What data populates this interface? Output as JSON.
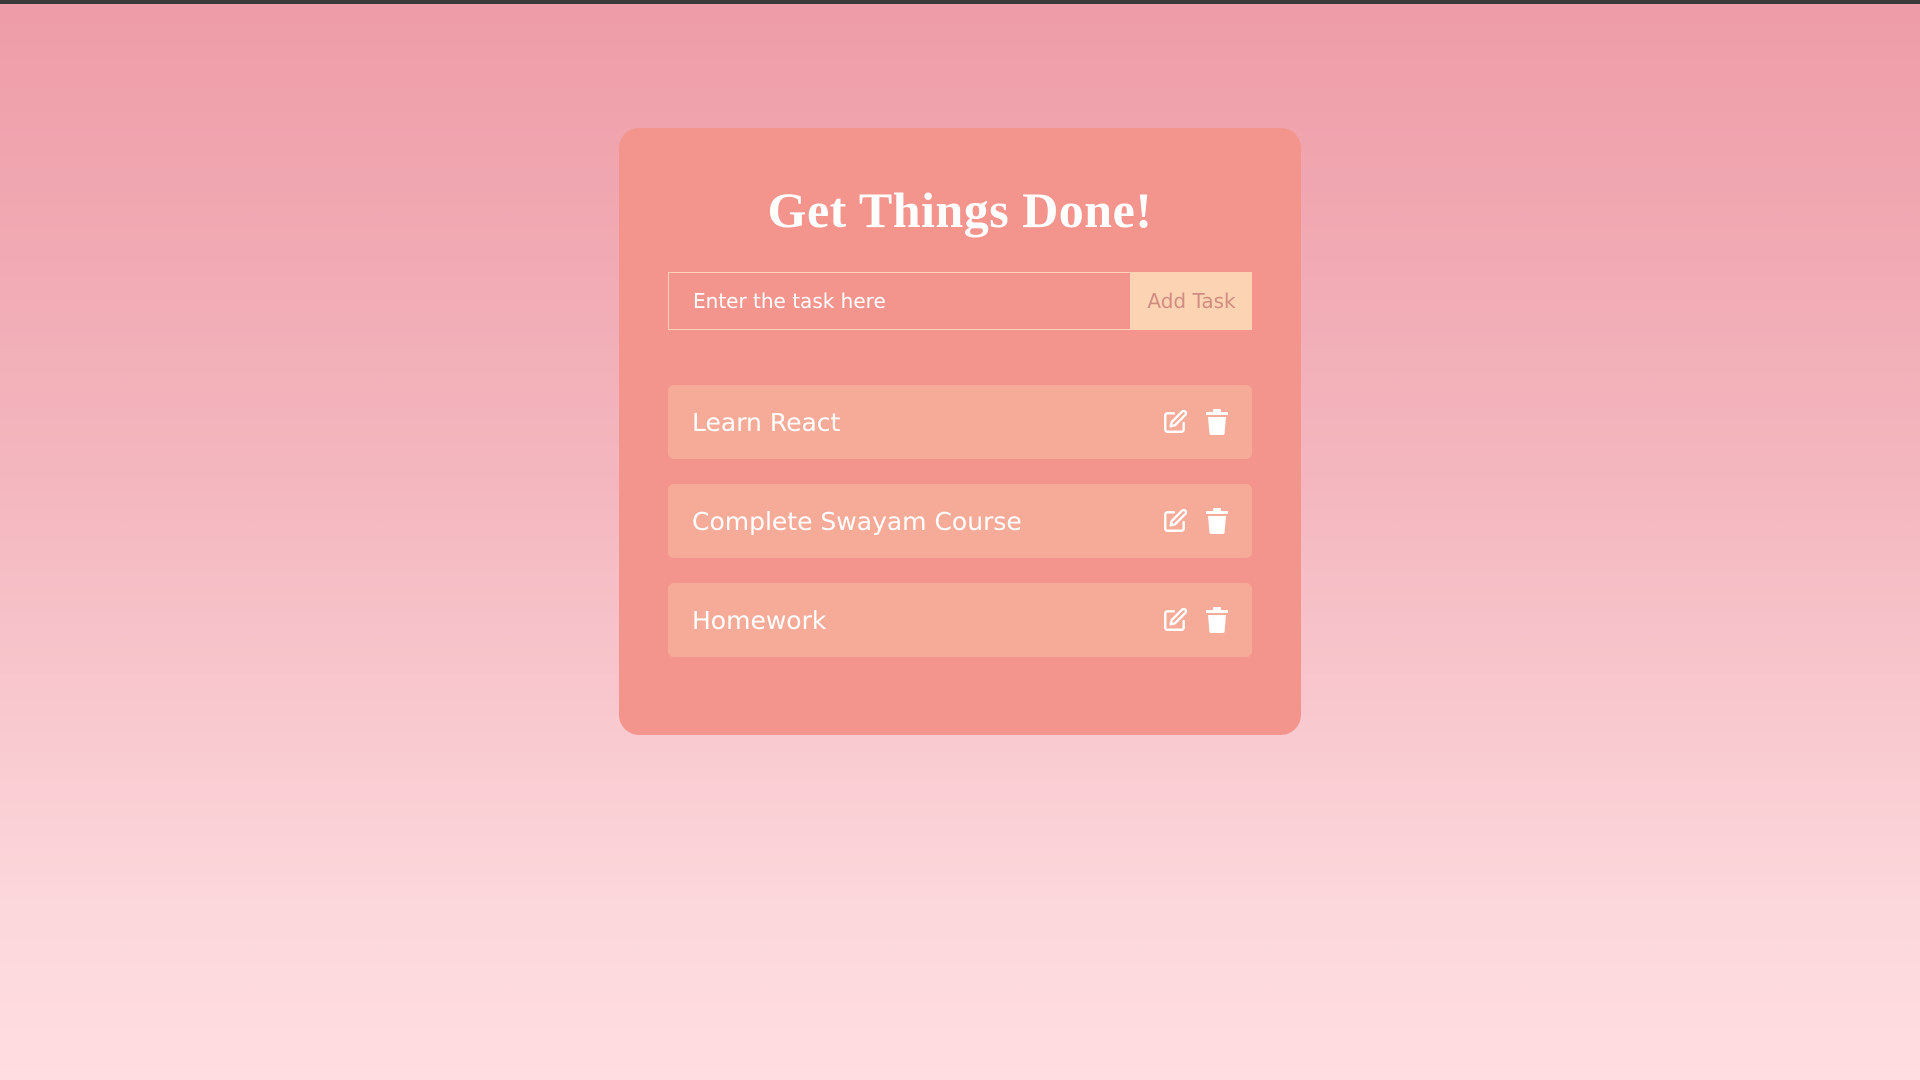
{
  "app": {
    "title": "Get Things Done!"
  },
  "form": {
    "input_placeholder": "Enter the task here",
    "input_value": "",
    "add_button_label": "Add Task"
  },
  "tasks": [
    {
      "label": "Learn React",
      "edit_icon": "edit-icon",
      "delete_icon": "trash-icon"
    },
    {
      "label": "Complete Swayam Course",
      "edit_icon": "edit-icon",
      "delete_icon": "trash-icon"
    },
    {
      "label": "Homework",
      "edit_icon": "edit-icon",
      "delete_icon": "trash-icon"
    }
  ],
  "colors": {
    "card_background": "#f3958d",
    "task_background": "#f6ab99",
    "add_button_background": "#fdd4b3",
    "add_button_text": "#d08c80",
    "text": "#ffffff"
  }
}
